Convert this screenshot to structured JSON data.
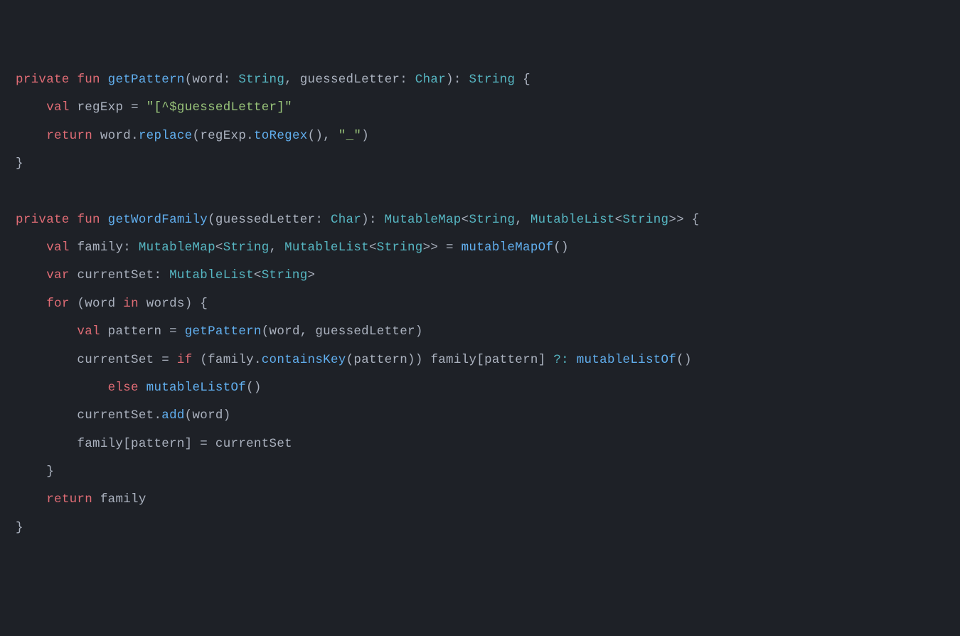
{
  "line1": {
    "private": "private",
    "fun": "fun",
    "fname": "getPattern",
    "p1name": "word",
    "p1type": "String",
    "p2name": "guessedLetter",
    "p2type": "Char",
    "rtype": "String",
    "brace": "{"
  },
  "line2": {
    "val": "val",
    "var": "regExp",
    "eq": "=",
    "str": "\"[^$guessedLetter]\""
  },
  "line3": {
    "return": "return",
    "word": "word",
    "replace": "replace",
    "regExp": "regExp",
    "toRegex": "toRegex",
    "us": "\"_\""
  },
  "line4": {
    "brace": "}"
  },
  "line6": {
    "private": "private",
    "fun": "fun",
    "fname": "getWordFamily",
    "p1name": "guessedLetter",
    "p1type": "Char",
    "rtype1": "MutableMap",
    "rtype2": "String",
    "rtype3": "MutableList",
    "rtype4": "String",
    "brace": "{"
  },
  "line7": {
    "val": "val",
    "family": "family",
    "MutableMap": "MutableMap",
    "String1": "String",
    "MutableList": "MutableList",
    "String2": "String",
    "eq": "=",
    "mutableMapOf": "mutableMapOf"
  },
  "line8": {
    "var": "var",
    "currentSet": "currentSet",
    "MutableList": "MutableList",
    "String": "String"
  },
  "line9": {
    "for": "for",
    "word": "word",
    "in": "in",
    "words": "words",
    "brace": "{"
  },
  "line10": {
    "val": "val",
    "pattern": "pattern",
    "eq": "=",
    "getPattern": "getPattern",
    "word": "word",
    "guessedLetter": "guessedLetter"
  },
  "line11": {
    "currentSet": "currentSet",
    "eq": "=",
    "if": "if",
    "family1": "family",
    "containsKey": "containsKey",
    "pattern1": "pattern",
    "family2": "family",
    "pattern2": "pattern",
    "elvis": "?:",
    "mutableListOf": "mutableListOf"
  },
  "line12": {
    "else": "else",
    "mutableListOf": "mutableListOf"
  },
  "line13": {
    "currentSet": "currentSet",
    "add": "add",
    "word": "word"
  },
  "line14": {
    "family": "family",
    "pattern": "pattern",
    "eq": "=",
    "currentSet": "currentSet"
  },
  "line15": {
    "brace": "}"
  },
  "line16": {
    "return": "return",
    "family": "family"
  },
  "line17": {
    "brace": "}"
  }
}
